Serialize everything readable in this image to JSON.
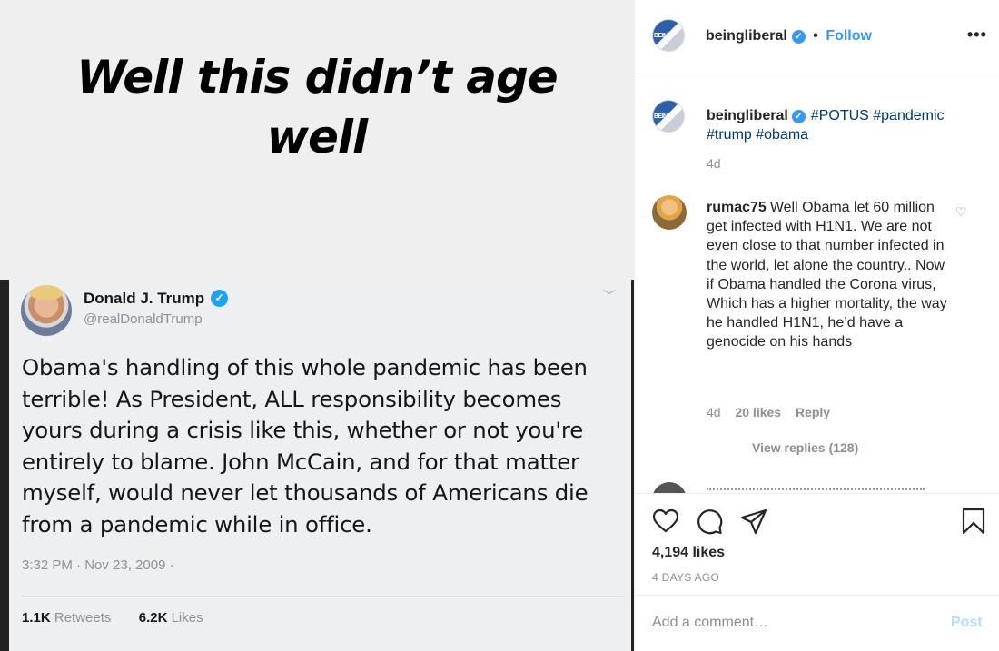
{
  "post_image": {
    "caption_line1": "Well this didn’t age",
    "caption_line2": "well",
    "tweet": {
      "name": "Donald J. Trump",
      "handle": "@realDonaldTrump",
      "text": "Obama's handling of this whole pandemic has been terrible! As President, ALL responsibility becomes yours during a crisis like this, whether or not you're entirely to blame. John McCain, and for that matter myself, would never let thousands of Americans die from a pandemic while in office.",
      "timestamp": "3:32 PM · Nov 23, 2009 ·",
      "retweets_count": "1.1K",
      "retweets_label": "Retweets",
      "likes_count": "6.2K",
      "likes_label": "Likes"
    }
  },
  "header": {
    "username": "beingliberal",
    "separator": "•",
    "follow_label": "Follow",
    "more_label": "•••"
  },
  "caption": {
    "username": "beingliberal",
    "hashtags_line1": "#POTUS #pandemic",
    "hashtags_line2": "#trump #obama",
    "age": "4d"
  },
  "comments": [
    {
      "username": "rumac75",
      "text": "Well Obama let 60 million get infected with H1N1. We are not even close to that number infected in the world, let alone the country.. Now if Obama handled the Corona virus, Which has a higher mortality, the way he handled H1N1, he’d have a genocide on his hands",
      "age": "4d",
      "likes": "20 likes",
      "reply_label": "Reply"
    }
  ],
  "view_replies": "View replies (128)",
  "actions": {
    "likes": "4,194 likes",
    "date": "4 DAYS AGO"
  },
  "add_comment": {
    "placeholder": "Add a comment…",
    "post_label": "Post"
  },
  "colors": {
    "link": "#3897f0",
    "hashtag": "#00376b",
    "twitter_blue": "#1da1f2"
  }
}
